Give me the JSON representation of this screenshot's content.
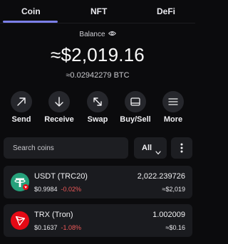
{
  "tabs": [
    {
      "label": "Coin",
      "active": true
    },
    {
      "label": "NFT",
      "active": false
    },
    {
      "label": "DeFi",
      "active": false
    }
  ],
  "balance": {
    "label": "Balance",
    "icon": "eye-icon",
    "value": "≈$2,019.16",
    "btc": "≈0.02942279 BTC"
  },
  "actions": [
    {
      "label": "Send",
      "icon": "arrow-up-right-icon"
    },
    {
      "label": "Receive",
      "icon": "arrow-down-icon"
    },
    {
      "label": "Swap",
      "icon": "swap-icon"
    },
    {
      "label": "Buy/Sell",
      "icon": "card-icon"
    },
    {
      "label": "More",
      "icon": "menu-icon"
    }
  ],
  "search": {
    "placeholder": "Search coins"
  },
  "filter": {
    "value": "All"
  },
  "coins": [
    {
      "name": "USDT (TRC20)",
      "price": "$0.9984",
      "change": "-0.02%",
      "amount": "2,022.239726",
      "value": "≈$2,019",
      "icon": "usdt-icon",
      "color": "#26a17b"
    },
    {
      "name": "TRX (Tron)",
      "price": "$0.1637",
      "change": "-1.08%",
      "amount": "1.002009",
      "value": "≈$0.16",
      "icon": "tron-icon",
      "color": "#e50915"
    }
  ],
  "colors": {
    "accent": "#7b7fe8",
    "negative": "#f05a5a",
    "background": "#0b0b0d",
    "surface": "#1a1b1f"
  }
}
